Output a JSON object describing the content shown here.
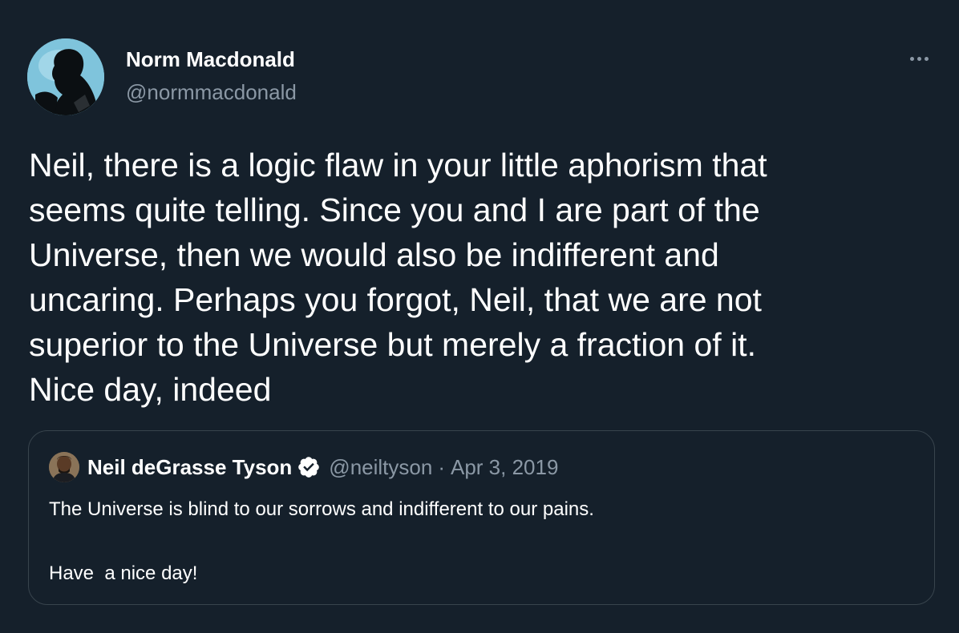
{
  "tweet": {
    "author": {
      "name": "Norm Macdonald",
      "handle": "@normmacdonald"
    },
    "text_lines": [
      "Neil, there is a logic flaw in your little aphorism that",
      "seems quite telling. Since you and I are part of the",
      "Universe, then we would also be indifferent and",
      "uncaring. Perhaps you forgot, Neil, that we are not",
      "superior to the Universe but merely a fraction of it.",
      "Nice day, indeed"
    ],
    "more_icon": "more-horizontal-icon"
  },
  "quoted_tweet": {
    "author": {
      "name": "Neil deGrasse Tyson",
      "handle": "@neiltyson",
      "verified": true
    },
    "separator": "·",
    "date": "Apr 3, 2019",
    "text_lines": [
      "The Universe is blind to our sorrows and indifferent to our pains.",
      "",
      "Have  a nice day!"
    ]
  },
  "colors": {
    "background": "#15202b",
    "text_primary": "#ffffff",
    "text_secondary": "#8b98a5",
    "border": "#38444d",
    "verified_badge": "#ffffff"
  }
}
